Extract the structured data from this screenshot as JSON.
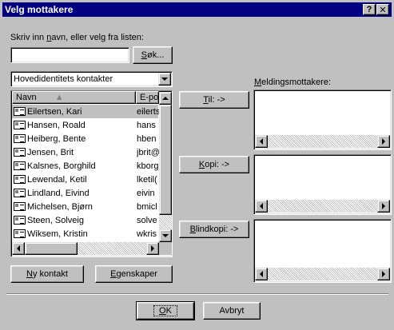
{
  "window": {
    "title": "Velg mottakere",
    "help_label": "?",
    "close_label": "✕"
  },
  "search": {
    "prompt_before": "Skriv inn ",
    "prompt_key": "n",
    "prompt_after": "avn, eller velg fra listen:",
    "value": "",
    "button_key": "S",
    "button_rest": "øk..."
  },
  "addressbook": {
    "selected": "Hovedidentitets kontakter"
  },
  "contacts": {
    "columns": [
      "Navn",
      "E-po:"
    ],
    "rows": [
      {
        "name": "Eilertsen, Kari",
        "email": "eilerts"
      },
      {
        "name": "Hansen, Roald",
        "email": "hans"
      },
      {
        "name": "Heiberg, Bente",
        "email": "hben"
      },
      {
        "name": "Jensen, Brit",
        "email": "jbrit@"
      },
      {
        "name": "Kalsnes, Borghild",
        "email": "kborg"
      },
      {
        "name": "Lewendal, Ketil",
        "email": "lketil("
      },
      {
        "name": "Lindland, Eivind",
        "email": "eivin"
      },
      {
        "name": "Michelsen, Bjørn",
        "email": "bmicl"
      },
      {
        "name": "Steen, Solveig",
        "email": "solve"
      },
      {
        "name": "Wiksem, Kristin",
        "email": "wkris"
      }
    ]
  },
  "recipients": {
    "label_key": "M",
    "label_rest": "eldingsmottakere:",
    "to_key": "T",
    "to_rest": "il: ->",
    "cc_key": "K",
    "cc_rest": "opi: ->",
    "bcc_key": "B",
    "bcc_rest": "lindkopi: ->"
  },
  "actions": {
    "new_contact_key": "N",
    "new_contact_rest": "y kontakt",
    "properties_key": "E",
    "properties_rest": "genskaper",
    "ok_key": "O",
    "ok_rest": "K",
    "cancel": "Avbryt"
  }
}
